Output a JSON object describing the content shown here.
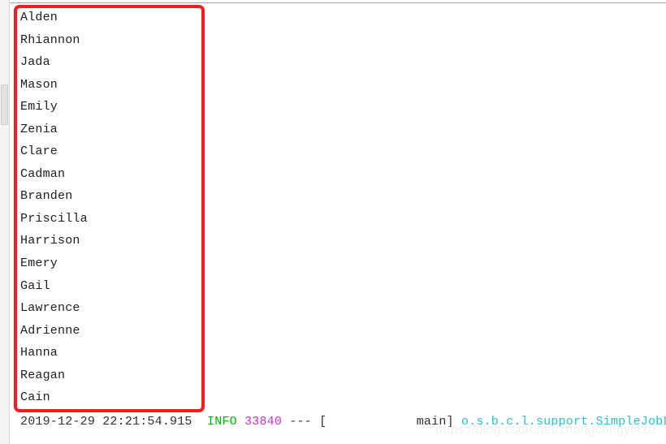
{
  "window": {
    "background_color": "#ffffff",
    "annotation_color": "#fb1b1b"
  },
  "scrollbar": {
    "name": "vertical-scrollbar",
    "thumb_color": "#e2e2e2",
    "track_color": "#f3f3f3"
  },
  "console": {
    "name_list": [
      "Alden",
      "Rhiannon",
      "Jada",
      "Mason",
      "Emily",
      "Zenia",
      "Clare",
      "Cadman",
      "Branden",
      "Priscilla",
      "Harrison",
      "Emery",
      "Gail",
      "Lawrence",
      "Adrienne",
      "Hanna",
      "Reagan",
      "Cain"
    ],
    "log_line": {
      "timestamp": "2019-12-29 22:21:54.915",
      "gap_1": "  ",
      "level": "INFO",
      "level_color": "#00bb00",
      "space_1": " ",
      "pid": "33840",
      "pid_color": "#cc33cc",
      "separator": " --- [",
      "thread_pad": "            ",
      "thread": "main]",
      "space_2": " ",
      "logger": "o.s.b.c.l.support.SimpleJobLau",
      "logger_color": "#25c4cc"
    }
  },
  "watermark": {
    "text": "https://blog.csdn.net/zhangcongyi420"
  }
}
